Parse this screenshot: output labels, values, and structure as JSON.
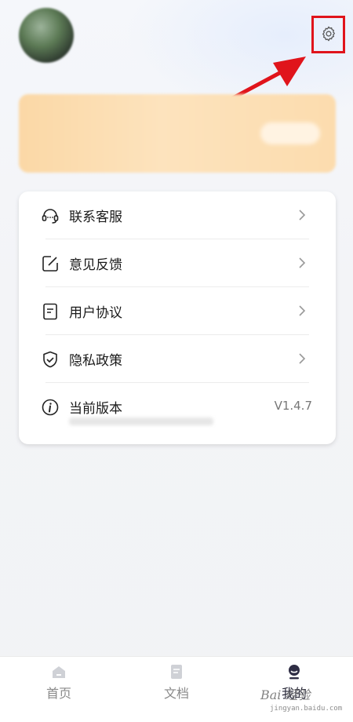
{
  "profile": {
    "name": "",
    "subtitle": ""
  },
  "vip_banner": {
    "title": "",
    "subtitle": "",
    "button": ""
  },
  "menu": {
    "items": [
      {
        "label": "联系客服",
        "icon": "headset-icon"
      },
      {
        "label": "意见反馈",
        "icon": "edit-icon"
      },
      {
        "label": "用户协议",
        "icon": "document-icon"
      },
      {
        "label": "隐私政策",
        "icon": "shield-check-icon"
      }
    ],
    "version": {
      "label": "当前版本",
      "value": "V1.4.7",
      "icon": "info-icon"
    }
  },
  "bottom_nav": {
    "items": [
      {
        "label": "首页",
        "icon": "home-icon"
      },
      {
        "label": "文档",
        "icon": "file-icon"
      },
      {
        "label": "我的",
        "icon": "user-icon",
        "active": true
      }
    ]
  },
  "watermark": {
    "text": "Bai 经验",
    "sub": "jingyan.baidu.com"
  },
  "colors": {
    "annotation": "#e0141b",
    "vip_gradient_start": "#fbd8a6",
    "card_background": "#ffffff"
  }
}
